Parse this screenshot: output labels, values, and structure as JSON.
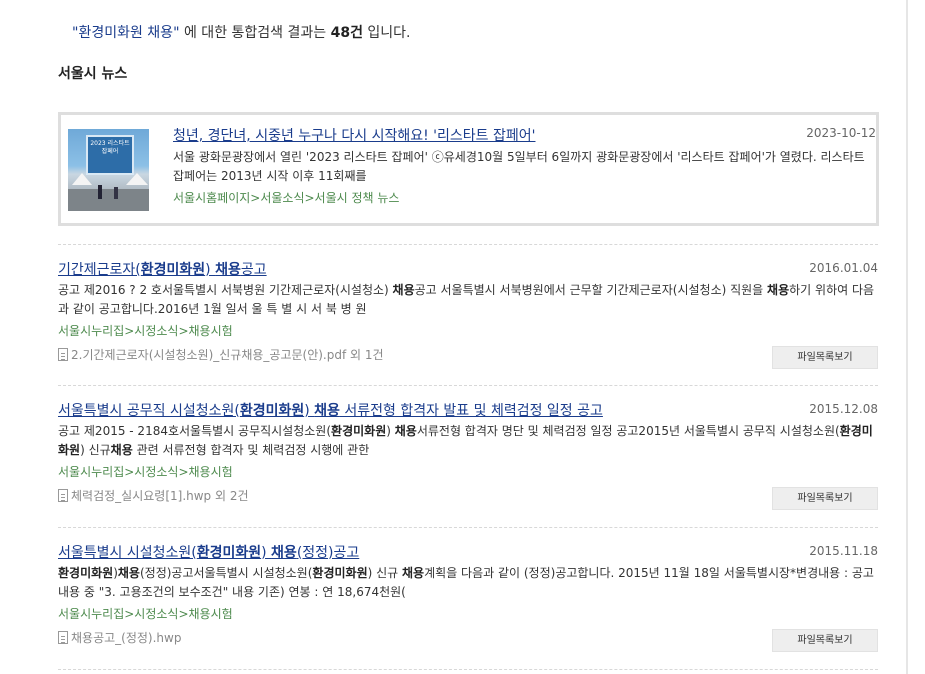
{
  "summary": {
    "open_quote": "\"",
    "query": "환경미화원 채용",
    "close_quote": "\"",
    "middle": " 에 대한 통합검색 결과는 ",
    "count": "48건",
    "end": " 입니다."
  },
  "section": {
    "title": "서울시 뉴스"
  },
  "news": {
    "title": "청년, 경단녀, 시중년 누구나 다시 시작해요! '리스타트 잡페어'",
    "date": "2023-10-12",
    "description": "서울 광화문광장에서 열린 '2023 리스타트 잡페어' ⓒ유세경10월 5일부터 6일까지 광화문광장에서 '리스타트 잡페어'가 열렸다. 리스타트 잡페어는 2013년 시작 이후 11회째를",
    "path": "서울시홈페이지>서울소식>서울시 정책 뉴스",
    "thumb_text": "2023 리스타트 잡페어"
  },
  "results": [
    {
      "title_parts": [
        "기간제근로자(",
        "환경미화원",
        ") ",
        "채용",
        "공고"
      ],
      "date": "2016.01.04",
      "desc_parts": [
        "공고 제2016 ? 2 호서울특별시 서북병원 기간제근로자(시설청소) ",
        "채용",
        "공고 서울특별시 서북병원에서 근무할 기간제근로자(시설청소) 직원을 ",
        "채용",
        "하기 위하여 다음과 같이 공고합니다.2016년 1월 일서 울 특 별 시 서 북 병 원"
      ],
      "path": "서울시누리집>시정소식>채용시험",
      "file": "2.기간제근로자(시설청소원)_신규채용_공고문(안).pdf 외 1건",
      "button": "파일목록보기"
    },
    {
      "title_parts": [
        "서울특별시 공무직 시설청소원(",
        "환경미화원",
        ") ",
        "채용",
        " 서류전형 합격자 발표 및 체력검정 일정 공고"
      ],
      "date": "2015.12.08",
      "desc_parts": [
        "공고 제2015 - 2184호서울특별시 공무직시설청소원(",
        "환경미화원",
        ") ",
        "채용",
        "서류전형 합격자 명단 및 체력검정 일정 공고2015년 서울특별시 공무직 시설청소원(",
        "환경미화원",
        ") 신규",
        "채용",
        " 관련 서류전형 합격자 및 체력검정 시행에 관한"
      ],
      "path": "서울시누리집>시정소식>채용시험",
      "file": "체력검정_실시요령[1].hwp 외 2건",
      "button": "파일목록보기"
    },
    {
      "title_parts": [
        "서울특별시 시설청소원(",
        "환경미화원",
        ") ",
        "채용",
        "(정정)공고"
      ],
      "date": "2015.11.18",
      "desc_parts": [
        "",
        "환경미화원",
        ")",
        "채용",
        "(정정)공고서울특별시 시설청소원(",
        "환경미화원",
        ") 신규 ",
        "채용",
        "계획을 다음과 같이 (정정)공고합니다. 2015년 11월 18일 서울특별시장*변경내용 : 공고내용 중 \"3. 고용조건의 보수조건\" 내용 기존) 연봉 : 연 18,674천원("
      ],
      "path": "서울시누리집>시정소식>채용시험",
      "file": "채용공고_(정정).hwp",
      "button": "파일목록보기"
    }
  ]
}
